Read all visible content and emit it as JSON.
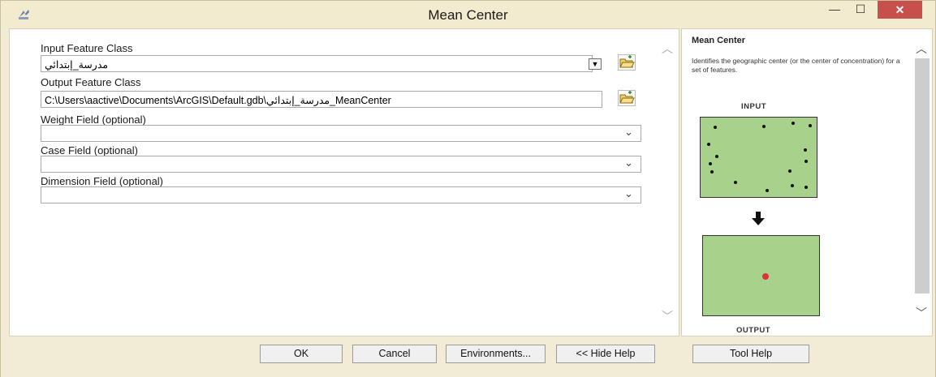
{
  "window": {
    "title": "Mean Center",
    "minimize_symbol": "—",
    "maximize_symbol": "☐",
    "close_symbol": "✕"
  },
  "form": {
    "input_feature_class": {
      "label": "Input Feature Class",
      "value": "مدرسة_إبتدائي"
    },
    "output_feature_class": {
      "label": "Output Feature Class",
      "value": "C:\\Users\\aactive\\Documents\\ArcGIS\\Default.gdb\\مدرسة_إبتدائي_MeanCenter"
    },
    "weight_field": {
      "label": "Weight Field (optional)",
      "value": ""
    },
    "case_field": {
      "label": "Case Field (optional)",
      "value": ""
    },
    "dimension_field": {
      "label": "Dimension Field (optional)",
      "value": ""
    }
  },
  "help": {
    "title": "Mean Center",
    "description": "Identifies the geographic center (or the center of concentration) for a set of features.",
    "input_label": "INPUT",
    "output_label": "OUTPUT"
  },
  "buttons": {
    "ok": "OK",
    "cancel": "Cancel",
    "environments": "Environments...",
    "hide_help": "<< Hide Help",
    "tool_help": "Tool Help"
  },
  "colors": {
    "window_bg": "#f2ecd6",
    "close_button": "#c7504c",
    "diagram_fill": "#a8d18b",
    "center_point": "#e0303a"
  },
  "icons": {
    "app": "arctoolbox-icon",
    "browse": "folder-open-icon",
    "dropdown": "chevron-down-icon",
    "flow": "arrow-down-icon"
  }
}
